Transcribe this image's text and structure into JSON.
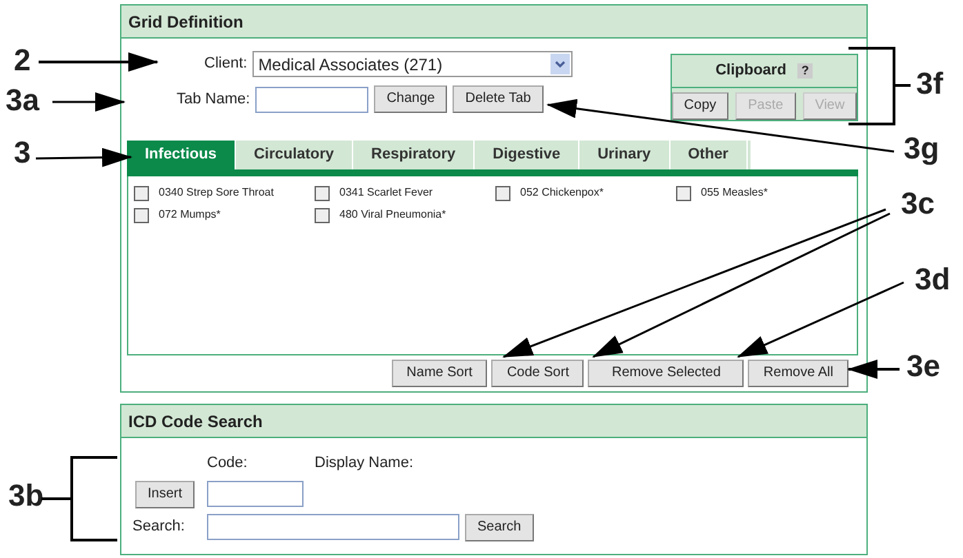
{
  "grid_definition": {
    "title": "Grid Definition",
    "client": {
      "label": "Client:",
      "value": "Medical Associates (271)"
    },
    "tab_name": {
      "label": "Tab Name:",
      "buttons": [
        "Change",
        "Delete Tab"
      ]
    },
    "clipboard": {
      "title": "Clipboard",
      "help": "?",
      "buttons": [
        {
          "label": "Copy",
          "disabled": false
        },
        {
          "label": "Paste",
          "disabled": true
        },
        {
          "label": "View",
          "disabled": true
        }
      ]
    },
    "tabs": [
      {
        "label": "Infectious",
        "selected": true
      },
      {
        "label": "Circulatory",
        "selected": false
      },
      {
        "label": "Respiratory",
        "selected": false
      },
      {
        "label": "Digestive",
        "selected": false
      },
      {
        "label": "Urinary",
        "selected": false
      },
      {
        "label": "Other",
        "selected": false
      }
    ],
    "items": [
      {
        "label": "0340 Strep Sore Throat",
        "checked": false
      },
      {
        "label": "0341 Scarlet Fever",
        "checked": false
      },
      {
        "label": "052 Chickenpox*",
        "checked": false
      },
      {
        "label": "055 Measles*",
        "checked": false
      },
      {
        "label": "072 Mumps*",
        "checked": false
      },
      {
        "label": "480 Viral Pneumonia*",
        "checked": false
      }
    ],
    "buttons": [
      "Name Sort",
      "Code Sort",
      "Remove Selected",
      "Remove All"
    ]
  },
  "icd_code_search": {
    "title": "ICD Code Search",
    "code_label": "Code:",
    "display_name_label": "Display Name:",
    "insert_button": "Insert",
    "search_label": "Search:",
    "search_button": "Search"
  },
  "callouts": [
    "2",
    "3a",
    "3",
    "3b",
    "3f",
    "3g",
    "3c",
    "3d",
    "3e"
  ]
}
